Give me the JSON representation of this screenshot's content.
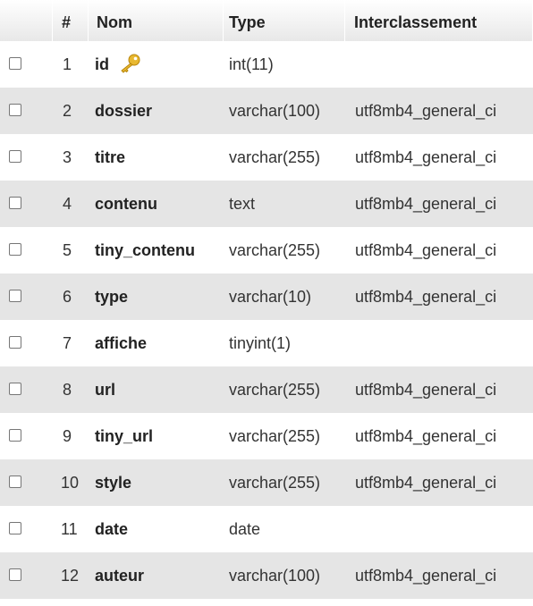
{
  "headers": {
    "num": "#",
    "name": "Nom",
    "type": "Type",
    "collation": "Interclassement"
  },
  "rows": [
    {
      "num": "1",
      "name": "id",
      "type": "int(11)",
      "collation": "",
      "primary_key": true
    },
    {
      "num": "2",
      "name": "dossier",
      "type": "varchar(100)",
      "collation": "utf8mb4_general_ci"
    },
    {
      "num": "3",
      "name": "titre",
      "type": "varchar(255)",
      "collation": "utf8mb4_general_ci"
    },
    {
      "num": "4",
      "name": "contenu",
      "type": "text",
      "collation": "utf8mb4_general_ci"
    },
    {
      "num": "5",
      "name": "tiny_contenu",
      "type": "varchar(255)",
      "collation": "utf8mb4_general_ci"
    },
    {
      "num": "6",
      "name": "type",
      "type": "varchar(10)",
      "collation": "utf8mb4_general_ci"
    },
    {
      "num": "7",
      "name": "affiche",
      "type": "tinyint(1)",
      "collation": ""
    },
    {
      "num": "8",
      "name": "url",
      "type": "varchar(255)",
      "collation": "utf8mb4_general_ci"
    },
    {
      "num": "9",
      "name": "tiny_url",
      "type": "varchar(255)",
      "collation": "utf8mb4_general_ci"
    },
    {
      "num": "10",
      "name": "style",
      "type": "varchar(255)",
      "collation": "utf8mb4_general_ci"
    },
    {
      "num": "11",
      "name": "date",
      "type": "date",
      "collation": ""
    },
    {
      "num": "12",
      "name": "auteur",
      "type": "varchar(100)",
      "collation": "utf8mb4_general_ci"
    }
  ],
  "icons": {
    "primary_key": "key-icon"
  },
  "colors": {
    "row_even": "#e5e5e5",
    "row_odd": "#ffffff",
    "key_gold": "#e8b830"
  }
}
